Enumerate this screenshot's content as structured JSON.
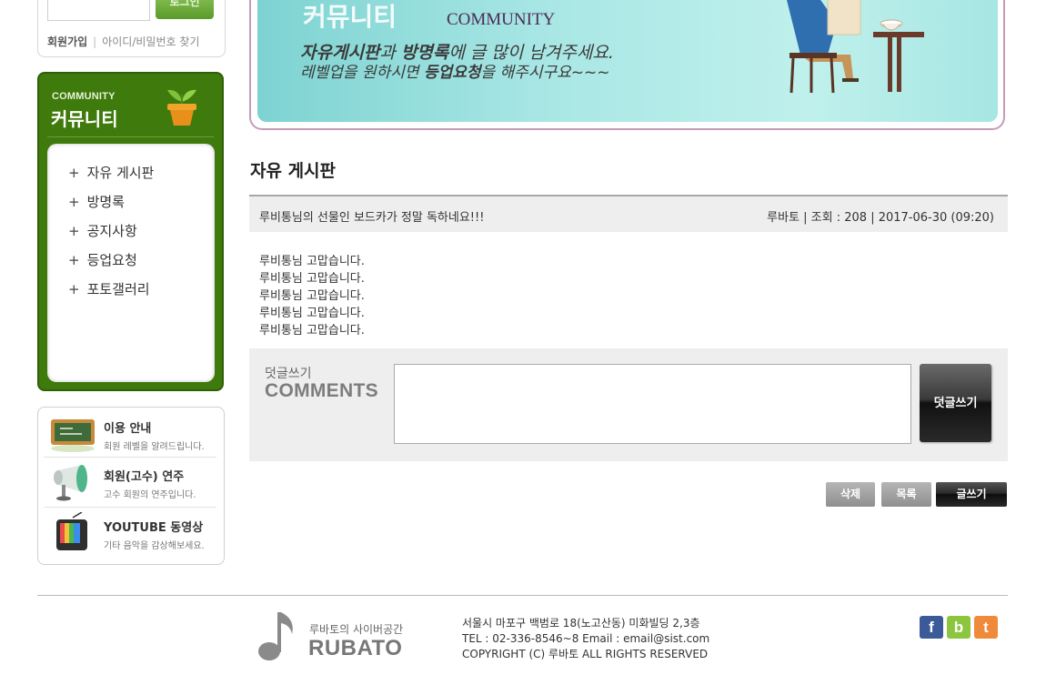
{
  "login": {
    "button_label": "로그인",
    "join_label": "회원가입",
    "separator": "|",
    "find_label": "아이디/비밀번호 찾기"
  },
  "community": {
    "title_en": "COMMUNITY",
    "title_ko": "커뮤니티",
    "items": [
      {
        "label": "자유 게시판"
      },
      {
        "label": "방명록"
      },
      {
        "label": "공지사항"
      },
      {
        "label": "등업요청"
      },
      {
        "label": "포토갤러리"
      }
    ],
    "plus": "+"
  },
  "info": {
    "items": [
      {
        "title": "이용 안내",
        "desc": "회원 레벨을 알려드립니다."
      },
      {
        "title": "회원(고수) 연주",
        "desc": "고수 회원의 연주입니다."
      },
      {
        "title": "YOUTUBE 동영상",
        "desc": "기타 음악을 감상해보세요."
      }
    ]
  },
  "banner": {
    "title_ko": "커뮤니티",
    "title_en": "COMMUNITY",
    "line1_b1": "자유게시판",
    "line1_t1": "과 ",
    "line1_b2": "방명록",
    "line1_t2": "에 글 많이 남겨주세요.",
    "line2_t1": "레벨업을 원하시면 ",
    "line2_b1": "등업요청",
    "line2_t2": "을 해주시구요~~~"
  },
  "board": {
    "title": "자유 게시판",
    "subject": "루비통님의 선물인 보드카가 정말 독하네요!!!",
    "meta": "루바토 | 조회 : 208 | 2017-06-30 (09:20)",
    "body_lines": [
      "루비통님 고맙습니다.",
      "루비통님 고맙습니다.",
      "루비통님 고맙습니다.",
      "루비통님 고맙습니다.",
      "루비통님 고맙습니다."
    ]
  },
  "comment": {
    "label_ko": "덧글쓰기",
    "label_en": "COMMENTS",
    "textarea_value": "",
    "submit_label": "덧글쓰기"
  },
  "actions": {
    "delete_label": "삭제",
    "list_label": "목록",
    "write_label": "글쓰기"
  },
  "footer": {
    "brand_sub": "루바토의 사이버공간",
    "brand": "RUBATO",
    "address": "서울시 마포구 백범로 18(노고산동) 미화빌딩 2,3층",
    "contact": "TEL : 02-336-8546~8 Email : email@sist.com",
    "copyright": "COPYRIGHT (C) 루바토 ALL RIGHTS RESERVED",
    "sns": [
      {
        "letter": "f",
        "icon": "facebook-icon",
        "color": "#3c5a98"
      },
      {
        "letter": "b",
        "icon": "blog-icon",
        "color": "#8cc63f"
      },
      {
        "letter": "t",
        "icon": "twitter-icon",
        "color": "#f08a3b"
      }
    ]
  },
  "colors": {
    "community_green": "#3f7a0c",
    "banner_teal": "#a9e7e5",
    "banner_frame": "#c39cbc"
  }
}
